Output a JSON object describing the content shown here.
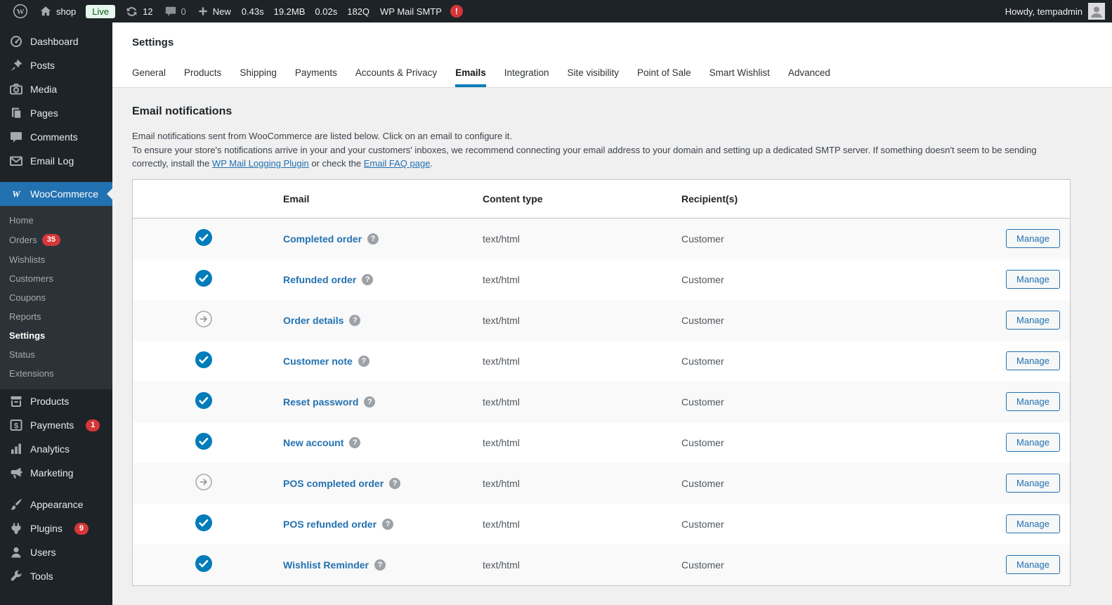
{
  "colors": {
    "accent": "#2271b1",
    "link_blue": "#2271b1",
    "admin_bar_bg": "#1d2327",
    "submenu_bg": "#2c3338",
    "content_bg": "#f0f0f1",
    "badge_red": "#d63638",
    "enabled_check": "#007cba",
    "live_badge_bg": "#e7f7ed",
    "live_badge_text": "#005c12",
    "row_stripe": "#f9f9f9",
    "border": "#c3c4c7"
  },
  "admin_bar": {
    "site": "shop",
    "live": "Live",
    "updates": "12",
    "comments": "0",
    "new_label": "New",
    "stats": [
      "0.43s",
      "19.2MB",
      "0.02s",
      "182Q"
    ],
    "smtp": "WP Mail SMTP",
    "smtp_badge": "!",
    "howdy": "Howdy, tempadmin"
  },
  "sidebar": {
    "top_items": [
      {
        "label": "Dashboard",
        "icon": "dashboard"
      },
      {
        "label": "Posts",
        "icon": "pushpin"
      },
      {
        "label": "Media",
        "icon": "camera"
      },
      {
        "label": "Pages",
        "icon": "pages"
      },
      {
        "label": "Comments",
        "icon": "comments"
      },
      {
        "label": "Email Log",
        "icon": "envelope"
      }
    ],
    "woocommerce_label": "WooCommerce",
    "woo_submenu": [
      {
        "label": "Home"
      },
      {
        "label": "Orders",
        "badge": "35"
      },
      {
        "label": "Wishlists"
      },
      {
        "label": "Customers"
      },
      {
        "label": "Coupons"
      },
      {
        "label": "Reports"
      },
      {
        "label": "Settings",
        "current": true
      },
      {
        "label": "Status"
      },
      {
        "label": "Extensions"
      }
    ],
    "bottom_items": [
      {
        "label": "Products",
        "icon": "archive-box"
      },
      {
        "label": "Payments",
        "icon": "dollar",
        "badge": "1"
      },
      {
        "label": "Analytics",
        "icon": "bar-chart"
      },
      {
        "label": "Marketing",
        "icon": "megaphone"
      },
      {
        "label": "Appearance",
        "icon": "paintbrush",
        "gap": true
      },
      {
        "label": "Plugins",
        "icon": "plug",
        "badge": "9"
      },
      {
        "label": "Users",
        "icon": "user"
      },
      {
        "label": "Tools",
        "icon": "wrench"
      }
    ]
  },
  "page": {
    "title": "Settings",
    "tabs": [
      {
        "label": "General"
      },
      {
        "label": "Products"
      },
      {
        "label": "Shipping"
      },
      {
        "label": "Payments"
      },
      {
        "label": "Accounts & Privacy"
      },
      {
        "label": "Emails",
        "active": true
      },
      {
        "label": "Integration"
      },
      {
        "label": "Site visibility"
      },
      {
        "label": "Point of Sale"
      },
      {
        "label": "Smart Wishlist"
      },
      {
        "label": "Advanced"
      }
    ],
    "section_heading": "Email notifications",
    "intro1": "Email notifications sent from WooCommerce are listed below. Click on an email to configure it.",
    "intro2_start": "To ensure your store's notifications arrive in your and your customers' inboxes, we recommend connecting your email address to your domain and setting up a dedicated SMTP server. If something doesn't seem to be sending correctly, install the ",
    "link_logging": "WP Mail Logging Plugin",
    "intro2_mid": " or check the ",
    "link_faq": "Email FAQ page",
    "intro2_end": "."
  },
  "table": {
    "headers": {
      "email": "Email",
      "content_type": "Content type",
      "recipients": "Recipient(s)"
    },
    "manage_label": "Manage",
    "rows": [
      {
        "name": "Completed order",
        "status": "enabled",
        "content_type": "text/html",
        "recipient": "Customer"
      },
      {
        "name": "Refunded order",
        "status": "enabled",
        "content_type": "text/html",
        "recipient": "Customer"
      },
      {
        "name": "Order details",
        "status": "manual",
        "content_type": "text/html",
        "recipient": "Customer"
      },
      {
        "name": "Customer note",
        "status": "enabled",
        "content_type": "text/html",
        "recipient": "Customer"
      },
      {
        "name": "Reset password",
        "status": "enabled",
        "content_type": "text/html",
        "recipient": "Customer"
      },
      {
        "name": "New account",
        "status": "enabled",
        "content_type": "text/html",
        "recipient": "Customer"
      },
      {
        "name": "POS completed order",
        "status": "manual",
        "content_type": "text/html",
        "recipient": "Customer"
      },
      {
        "name": "POS refunded order",
        "status": "enabled",
        "content_type": "text/html",
        "recipient": "Customer"
      },
      {
        "name": "Wishlist Reminder",
        "status": "enabled",
        "content_type": "text/html",
        "recipient": "Customer"
      }
    ]
  }
}
